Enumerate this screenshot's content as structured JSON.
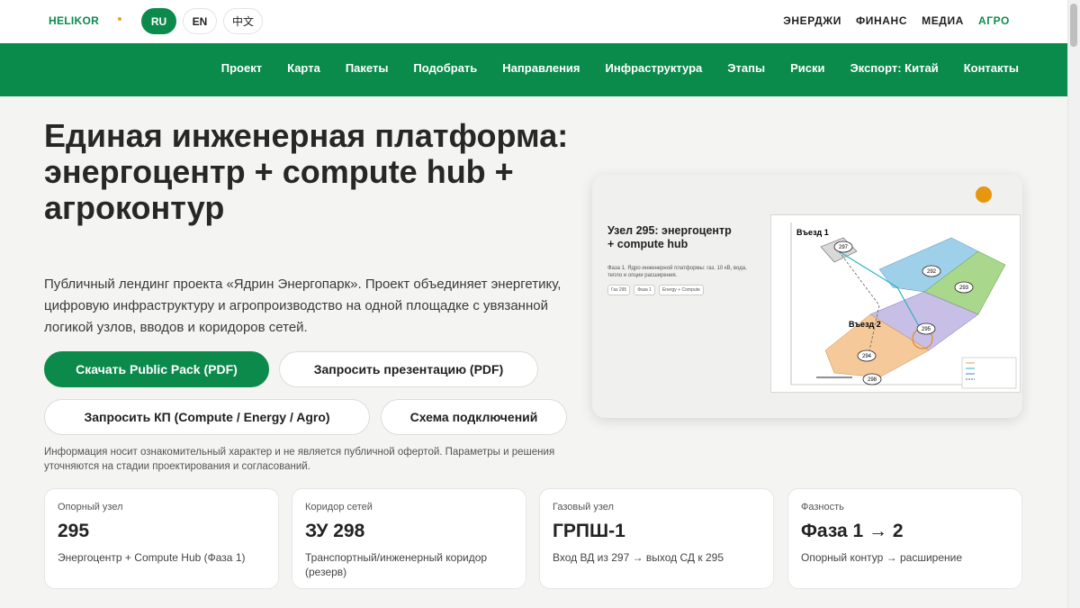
{
  "brand": "HELIKOR",
  "languages": [
    {
      "label": "RU",
      "active": true
    },
    {
      "label": "EN",
      "active": false
    },
    {
      "label": "中文",
      "active": false
    }
  ],
  "top_nav": [
    "ЭНЕРДЖИ",
    "ФИНАНС",
    "МЕДИА",
    "АГРО"
  ],
  "main_nav": [
    "Проект",
    "Карта",
    "Пакеты",
    "Подобрать",
    "Направления",
    "Инфраструктура",
    "Этапы",
    "Риски",
    "Экспорт: Китай",
    "Контакты"
  ],
  "hero": {
    "title": "Единая инженерная платформа: энергоцентр + compute hub + агроконтур",
    "text": "Публичный лендинг проекта «Ядрин Энергопарк». Проект объединяет энергетику, цифровую инфраструктуру и агропроизводство на одной площадке с увязанной логикой узлов, вводов и коридоров сетей.",
    "buttons": {
      "download": "Скачать Public Pack (PDF)",
      "presentation": "Запросить презентацию (PDF)",
      "offer": "Запросить КП (Compute / Energy / Agro)",
      "scheme": "Схема подключений"
    },
    "disclaimer": "Информация носит ознакомительный характер и не является публичной офертой. Параметры и решения уточняются на стадии проектирования и согласований."
  },
  "preview": {
    "title": "Узел 295: энергоцентр + compute hub",
    "subtitle": "Фаза 1. Ядро инженерной платформы: газ, 10 кВ, вода, тепло и опции расширения.",
    "chips": [
      "Газ 295",
      "Фаза 1",
      "Energy + Compute"
    ],
    "map_labels": {
      "entry1": "Въезд 1",
      "entry2": "Въезд 2",
      "nodes": [
        "297",
        "292",
        "293",
        "295",
        "294",
        "298"
      ]
    }
  },
  "stats": [
    {
      "label": "Опорный узел",
      "value": "295",
      "desc": "Энергоцентр + Compute Hub (Фаза 1)"
    },
    {
      "label": "Коридор сетей",
      "value": "ЗУ 298",
      "desc": "Транспортный/инженерный коридор (резерв)"
    },
    {
      "label": "Газовый узел",
      "value": "ГРПШ-1",
      "desc": "Вход ВД из 297 → выход СД к 295"
    },
    {
      "label": "Фазность",
      "value": "Фаза 1 → 2",
      "desc": "Опорный контур → расширение"
    }
  ],
  "colors": {
    "brand_green": "#0a8a4b",
    "accent_orange": "#e7960f"
  }
}
